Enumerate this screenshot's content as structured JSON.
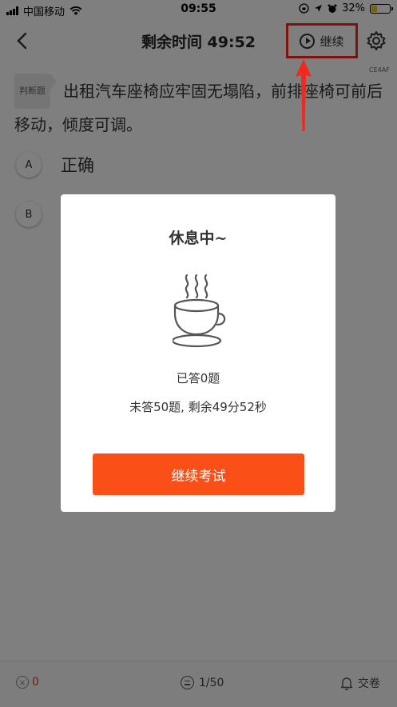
{
  "status_bar": {
    "carrier": "中国移动",
    "time": "09:55",
    "battery_percent": "32%",
    "battery_level": 0.32
  },
  "nav": {
    "title": "剩余时间 49:52",
    "continue_label": "继续"
  },
  "question": {
    "type_label": "判断题",
    "text": "出租汽车座椅应牢固无塌陷，前排座椅可前后移动，倾度可调。",
    "code": "CE4AF",
    "options": [
      {
        "letter": "A",
        "text": "正确"
      },
      {
        "letter": "B",
        "text": ""
      }
    ]
  },
  "bottom_bar": {
    "wrong_count": "0",
    "progress": "1/50",
    "submit_label": "交卷"
  },
  "modal": {
    "title": "休息中~",
    "answered": "已答0题",
    "remaining": "未答50题, 剩余49分52秒",
    "button_label": "继续考试"
  },
  "colors": {
    "accent": "#fa5018",
    "annotation_red": "#f2281f",
    "wrong_red": "#e03a2f"
  }
}
